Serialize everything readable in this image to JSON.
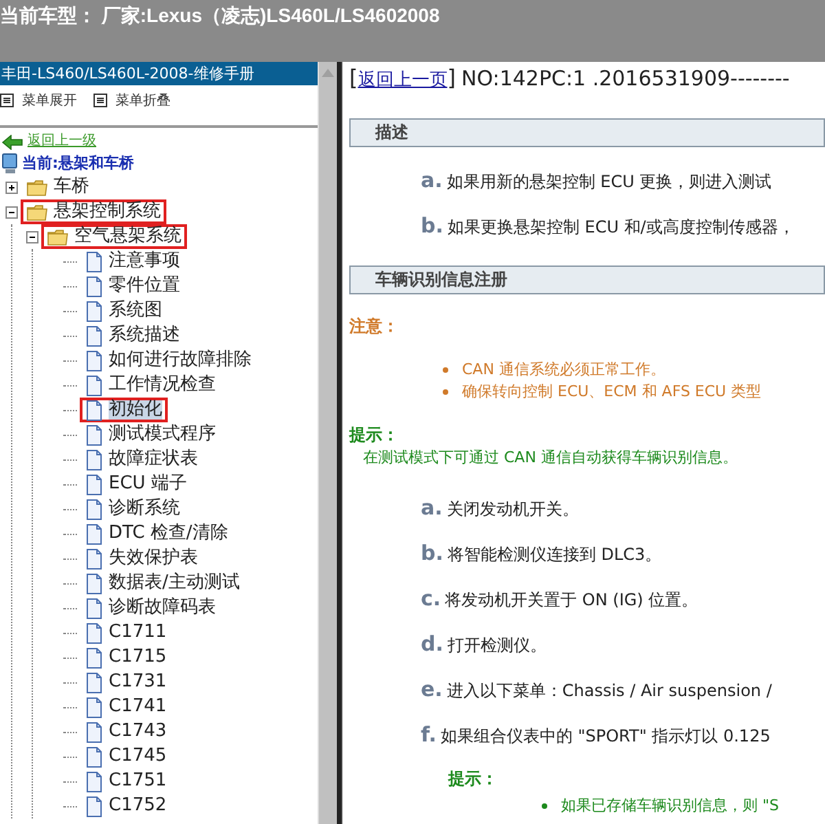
{
  "header": {
    "title": "当前车型： 厂家:Lexus（凌志)LS460L/LS4602008"
  },
  "sidebar": {
    "title": "丰田-LS460/LS460L-2008-维修手册",
    "menu_buttons": [
      "菜单展开",
      "菜单折叠"
    ],
    "back_link": "返回上一级",
    "current": "当前:悬架和车桥",
    "tree": [
      {
        "label": "车桥",
        "kind": "folder",
        "expanded": false,
        "highlighted": false,
        "selected": false
      },
      {
        "label": "悬架控制系统",
        "kind": "folder",
        "expanded": true,
        "highlighted": true,
        "selected": false,
        "children": [
          {
            "label": "空气悬架系统",
            "kind": "folder",
            "expanded": true,
            "highlighted": true,
            "selected": false,
            "children": [
              {
                "label": "注意事项",
                "kind": "page",
                "highlighted": false,
                "selected": false
              },
              {
                "label": "零件位置",
                "kind": "page",
                "highlighted": false,
                "selected": false
              },
              {
                "label": "系统图",
                "kind": "page",
                "highlighted": false,
                "selected": false
              },
              {
                "label": "系统描述",
                "kind": "page",
                "highlighted": false,
                "selected": false
              },
              {
                "label": "如何进行故障排除",
                "kind": "page",
                "highlighted": false,
                "selected": false
              },
              {
                "label": "工作情况检查",
                "kind": "page",
                "highlighted": false,
                "selected": false
              },
              {
                "label": "初始化",
                "kind": "page",
                "highlighted": true,
                "selected": true
              },
              {
                "label": "测试模式程序",
                "kind": "page",
                "highlighted": false,
                "selected": false
              },
              {
                "label": "故障症状表",
                "kind": "page",
                "highlighted": false,
                "selected": false
              },
              {
                "label": "ECU 端子",
                "kind": "page",
                "highlighted": false,
                "selected": false
              },
              {
                "label": "诊断系统",
                "kind": "page",
                "highlighted": false,
                "selected": false
              },
              {
                "label": "DTC 检查/清除",
                "kind": "page",
                "highlighted": false,
                "selected": false
              },
              {
                "label": "失效保护表",
                "kind": "page",
                "highlighted": false,
                "selected": false
              },
              {
                "label": "数据表/主动测试",
                "kind": "page",
                "highlighted": false,
                "selected": false
              },
              {
                "label": "诊断故障码表",
                "kind": "page",
                "highlighted": false,
                "selected": false
              },
              {
                "label": "C1711",
                "kind": "page",
                "highlighted": false,
                "selected": false
              },
              {
                "label": "C1715",
                "kind": "page",
                "highlighted": false,
                "selected": false
              },
              {
                "label": "C1731",
                "kind": "page",
                "highlighted": false,
                "selected": false
              },
              {
                "label": "C1741",
                "kind": "page",
                "highlighted": false,
                "selected": false
              },
              {
                "label": "C1743",
                "kind": "page",
                "highlighted": false,
                "selected": false
              },
              {
                "label": "C1745",
                "kind": "page",
                "highlighted": false,
                "selected": false
              },
              {
                "label": "C1751",
                "kind": "page",
                "highlighted": false,
                "selected": false
              },
              {
                "label": "C1752",
                "kind": "page",
                "highlighted": false,
                "selected": false
              }
            ]
          }
        ]
      }
    ]
  },
  "content": {
    "bracket_open": "[",
    "back_link": "返回上一页",
    "bracket_close": "]",
    "doc_id": "NO:142PC:1 .2016531909--------",
    "blocks": [
      {
        "kind": "section",
        "text": "描述"
      },
      {
        "kind": "step",
        "marker": "a.",
        "text": "如果用新的悬架控制 ECU 更换，则进入测试"
      },
      {
        "kind": "step",
        "marker": "b.",
        "text": "如果更换悬架控制 ECU 和/或高度控制传感器，"
      },
      {
        "kind": "section",
        "text": "车辆识别信息注册"
      },
      {
        "kind": "caution_title",
        "text": "注意："
      },
      {
        "kind": "caution_item",
        "text": "CAN 通信系统必须正常工作。"
      },
      {
        "kind": "caution_item",
        "text": "确保转向控制 ECU、ECM 和 AFS ECU 类型"
      },
      {
        "kind": "hint_title",
        "text": "提示："
      },
      {
        "kind": "hint_text",
        "text": "在测试模式下可通过 CAN 通信自动获得车辆识别信息。"
      },
      {
        "kind": "step",
        "marker": "a.",
        "text": "关闭发动机开关。"
      },
      {
        "kind": "step",
        "marker": "b.",
        "text": "将智能检测仪连接到 DLC3。"
      },
      {
        "kind": "step",
        "marker": "c.",
        "text": "将发动机开关置于 ON (IG) 位置。"
      },
      {
        "kind": "step",
        "marker": "d.",
        "text": "打开检测仪。"
      },
      {
        "kind": "step",
        "marker": "e.",
        "text": "进入以下菜单：Chassis / Air suspension /"
      },
      {
        "kind": "step",
        "marker": "f.",
        "text": "如果组合仪表中的 \"SPORT\" 指示灯以 0.125"
      },
      {
        "kind": "sub_hint_title",
        "text": "提示："
      },
      {
        "kind": "hint_item",
        "text": "如果已存储车辆识别信息，则 \"S"
      }
    ]
  }
}
